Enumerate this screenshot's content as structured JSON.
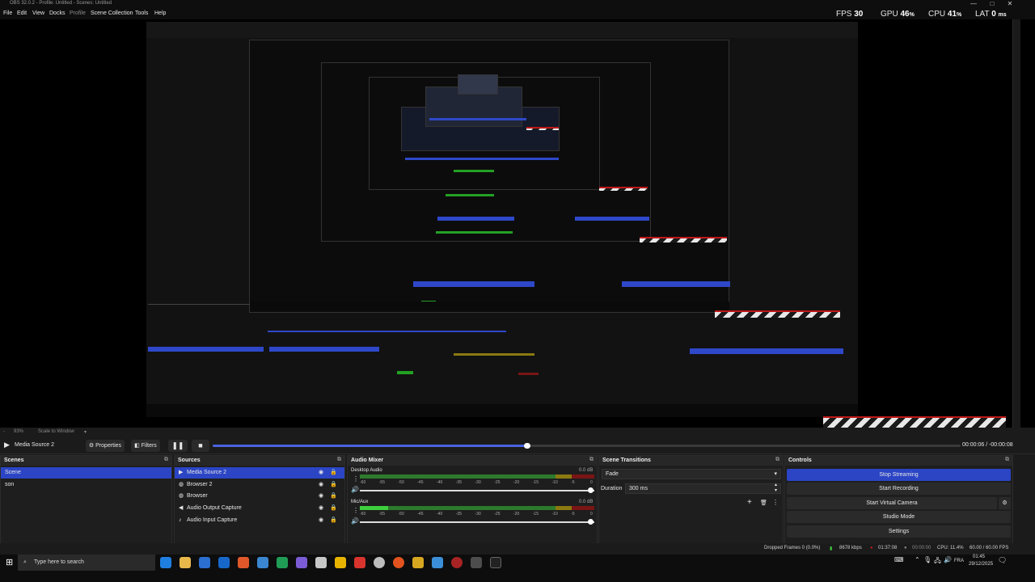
{
  "window": {
    "title": "OBS 32.0.2 - Profile: Untitled - Scenes: Untitled",
    "minimize": "—",
    "maximize": "□",
    "close": "✕"
  },
  "menu": [
    "File",
    "Edit",
    "View",
    "Docks",
    "Profile",
    "Scene Collection",
    "Tools",
    "Help"
  ],
  "stats": {
    "fps_label": "FPS",
    "fps": "30",
    "gpu_label": "GPU",
    "gpu": "46",
    "cpu_label": "CPU",
    "cpu": "41",
    "lat_label": "LAT",
    "lat": "0",
    "pct": "%",
    "ms": "ms"
  },
  "zoom": {
    "percent": "93%",
    "scale_mode": "Scale to Window",
    "separator": "-"
  },
  "media": {
    "source_name": "Media Source 2",
    "properties_label": "Properties",
    "filters_label": "Filters",
    "time": "00:00:06  /  -00:00:08",
    "progress": 0.42
  },
  "scenes": {
    "title": "Scenes",
    "items": [
      {
        "label": "Scene",
        "selected": true
      },
      {
        "label": "son",
        "selected": false
      }
    ]
  },
  "sources": {
    "title": "Sources",
    "items": [
      {
        "label": "Media Source 2",
        "icon": "play-icon",
        "selected": true
      },
      {
        "label": "Browser 2",
        "icon": "globe-icon",
        "selected": false
      },
      {
        "label": "Browser",
        "icon": "globe-icon",
        "selected": false
      },
      {
        "label": "Audio Output Capture",
        "icon": "speaker-icon",
        "selected": false
      },
      {
        "label": "Audio Input Capture",
        "icon": "microphone-icon",
        "selected": false
      }
    ]
  },
  "mixer": {
    "title": "Audio Mixer",
    "channels": [
      {
        "name": "Desktop Audio",
        "db": "0.0 dB",
        "level": 0.0
      },
      {
        "name": "Mic/Aux",
        "db": "0.0 dB",
        "level": 0.12
      }
    ],
    "scale_labels": [
      "-60",
      "-55",
      "-50",
      "-45",
      "-40",
      "-35",
      "-30",
      "-25",
      "-20",
      "-15",
      "-10",
      "-5",
      "0"
    ]
  },
  "transitions": {
    "title": "Scene Transitions",
    "selected": "Fade",
    "duration_label": "Duration",
    "duration_value": "300 ms"
  },
  "controls": {
    "title": "Controls",
    "buttons": [
      {
        "label": "Stop Streaming",
        "active": true
      },
      {
        "label": "Start Recording",
        "active": false
      },
      {
        "label": "Start Virtual Camera",
        "active": false
      },
      {
        "label": "Studio Mode",
        "active": false
      },
      {
        "label": "Settings",
        "active": false
      }
    ]
  },
  "status": {
    "dropped": "Dropped Frames 0 (0.0%)",
    "bitrate": "8678 kbps",
    "stream_time": "01:37:08",
    "rec_time": "00:00:00",
    "cpu": "CPU: 11.4%",
    "fps": "60.00 / 60.00 FPS"
  },
  "taskbar": {
    "search_placeholder": "Type here to search",
    "language": "FRA",
    "time": "01:45",
    "date": "29/12/2025"
  },
  "colors": {
    "accent": "#2b45c5",
    "meter_green": "#3ecf3e",
    "meter_yellow": "#8a7a10",
    "meter_red": "#7a1515",
    "hazard_red": "#c01818"
  }
}
